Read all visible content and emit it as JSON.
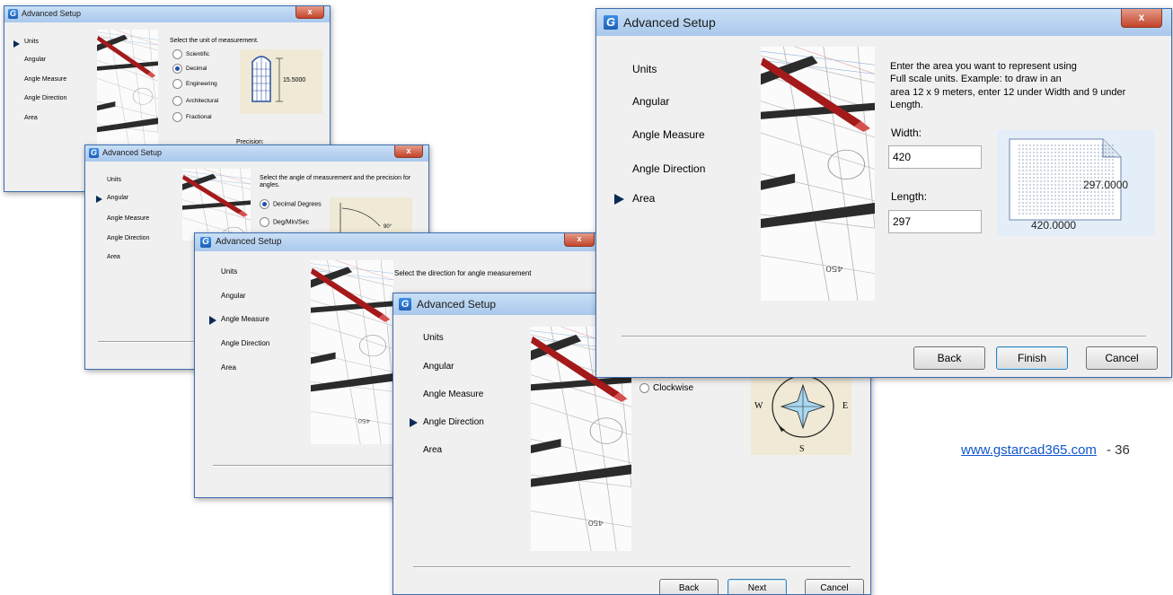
{
  "dialog_title": "Advanced Setup",
  "close_glyph": "x",
  "nav_items": [
    "Units",
    "Angular",
    "Angle Measure",
    "Angle Direction",
    "Area"
  ],
  "units_dialog": {
    "prompt": "Select the unit of measurement.",
    "options": [
      "Scientific",
      "Decimal",
      "Engineering",
      "Architectural",
      "Fractional"
    ],
    "selected": "Decimal",
    "preview_value": "15.5000",
    "precision_label": "Precision:"
  },
  "angular_dialog": {
    "prompt": "Select the angle of measurement and the precision for angles.",
    "options": [
      "Decimal Degrees",
      "Deg/Min/Sec"
    ],
    "selected": "Decimal Degrees",
    "preview_value": "90°"
  },
  "angle_measure_dialog": {
    "prompt": "Select the direction for angle measurement"
  },
  "angle_direction_dialog": {
    "options": [
      "Clockwise"
    ],
    "compass": {
      "w": "W",
      "e": "E",
      "s": "S"
    },
    "buttons": {
      "back": "Back",
      "next": "Next",
      "cancel": "Cancel"
    }
  },
  "area_dialog": {
    "instructions_1": "Enter the area you want to represent using",
    "instructions_2": "Full scale units. Example: to draw in an",
    "instructions_3": "area 12 x 9 meters, enter 12 under Width and 9 under",
    "instructions_4": "Length.",
    "width_label": "Width:",
    "width_value": "420",
    "length_label": "Length:",
    "length_value": "297",
    "preview_width": "420.0000",
    "preview_length": "297.0000",
    "buttons": {
      "back": "Back",
      "finish": "Finish",
      "cancel": "Cancel"
    }
  },
  "footer": {
    "url": "www.gstarcad365.com",
    "page_suffix": "- 36"
  }
}
